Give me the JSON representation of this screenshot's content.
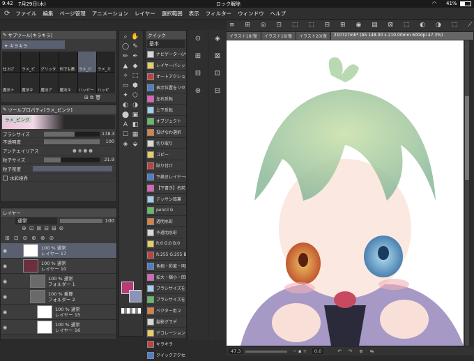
{
  "status": {
    "time": "9:42",
    "date": "7月29日(木)",
    "lock": "ロック解除",
    "battery": "41%"
  },
  "menu": [
    "ファイル",
    "編集",
    "ページ管理",
    "アニメーション",
    "レイヤー",
    "選択範囲",
    "表示",
    "フィルター",
    "ウィンドウ",
    "ヘルプ"
  ],
  "subtool": {
    "title": "サブツール[キラキラ]",
    "tab": "キラキラ",
    "row1": [
      "仕上げ",
      "ラメ_ピ",
      "グリッタ",
      "何でも散",
      "ラメ_ピ",
      "ラメ_カ"
    ],
    "row2": [
      "魔法ト",
      "魔法キ",
      "魔法ア",
      "魔法キ",
      "ハッピー",
      "ハッピ"
    ]
  },
  "toolprop": {
    "title": "ツールプロパティ[ラメ_ピンク]",
    "brushname": "ラメ_ピンク",
    "rows": [
      {
        "label": "ブラシサイズ",
        "value": "178.3",
        "fill": 0.55
      },
      {
        "label": "不透明度",
        "value": "100",
        "fill": 1.0
      },
      {
        "label": "アンチエイリアス",
        "value": ""
      },
      {
        "label": "粒子サイズ",
        "value": "21.9",
        "fill": 0.3
      },
      {
        "label": "粒子密度",
        "value": ""
      },
      {
        "label": "水彩境界",
        "value": ""
      }
    ]
  },
  "layers": {
    "title": "レイヤー",
    "blend": "通常",
    "opacity": "100",
    "items": [
      {
        "l1": "100 % 通常",
        "l2": "レイヤー 17",
        "sel": true,
        "indent": 0,
        "thumb": "#ffffff"
      },
      {
        "l1": "100 % 通常",
        "l2": "レイヤー 10",
        "sel": false,
        "indent": 0,
        "thumb": "#6a3040"
      },
      {
        "l1": "100 % 通常",
        "l2": "フォルダー 1",
        "sel": false,
        "indent": 1,
        "thumb": "folder"
      },
      {
        "l1": "100 % 乗算",
        "l2": "フォルダー 2",
        "sel": false,
        "indent": 1,
        "thumb": "folder"
      },
      {
        "l1": "100 % 通常",
        "l2": "レイヤー 15",
        "sel": false,
        "indent": 2,
        "thumb": "#ffffff"
      },
      {
        "l1": "100 % 通常",
        "l2": "レイヤー 16",
        "sel": false,
        "indent": 2,
        "thumb": "#ffffff"
      }
    ]
  },
  "quick": {
    "title": "クイック",
    "preset": "基本",
    "items": [
      "ナビゲーター(パ",
      "レイヤーパレット",
      "オートアクション",
      "表示位置をリセ",
      "左右反転",
      "上下反転",
      "オブジェクト",
      "投げなわ選択",
      "切り取り",
      "コピー",
      "貼り付け",
      "下描きレイヤーの",
      "【下書き】名前",
      "デッサン鉛筆",
      "pencil G",
      "透明水彩",
      "不透明水彩",
      "R:0 G:0 B:0",
      "R:255 G:255 B:2",
      "色相・彩度・明度",
      "拡大・縮小・回転",
      "ブラシサイズを",
      "ブラシサイズを",
      "ベクター用 2",
      "髪影グラデ",
      "デコレーション",
      "キラキラ",
      "クイックアクセス"
    ]
  },
  "doc": {
    "tabs": [
      "イラスト18(復",
      "イラスト16(復",
      "イラスト20(復",
      "210727mk* (A5 148.00 x 210.00mm 600dpi 47.3%)"
    ],
    "zoom": "47.3",
    "angle": "0.0"
  },
  "colors": {
    "main": "#b83a78",
    "sub": "#8b94b8",
    "accent": "#4a7fd0"
  }
}
